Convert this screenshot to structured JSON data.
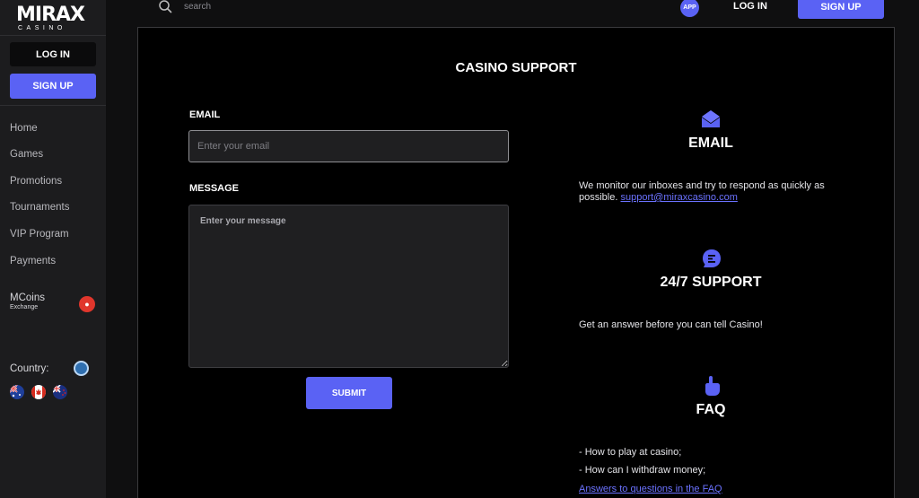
{
  "logo": {
    "main": "MIRAX",
    "sub": "CASINO"
  },
  "sidebar": {
    "login_label": "LOG IN",
    "signup_label": "SIGN UP",
    "nav": [
      "Home",
      "Games",
      "Promotions",
      "Tournaments",
      "VIP Program",
      "Payments"
    ],
    "mcoins": {
      "title": "MCoins",
      "subtitle": "Exchange"
    },
    "country_label": "Country:"
  },
  "topbar": {
    "search_placeholder": "search",
    "app_label": "APP",
    "login_label": "LOG IN",
    "signup_label": "SIGN UP"
  },
  "page": {
    "title": "CASINO SUPPORT",
    "form": {
      "email_label": "EMAIL",
      "email_placeholder": "Enter your email",
      "message_label": "MESSAGE",
      "message_placeholder": "Enter your message",
      "submit_label": "SUBMIT"
    },
    "email_info": {
      "heading": "EMAIL",
      "text": "We monitor our inboxes and try to respond as quickly as possible.",
      "link": "support@miraxcasino.com"
    },
    "support_info": {
      "heading": "24/7 SUPPORT",
      "text": "Get an answer before you can tell Casino!"
    },
    "faq_info": {
      "heading": "FAQ",
      "items": [
        "- How to play at casino;",
        "- How can I withdraw money;"
      ],
      "link": "Answers to questions in the FAQ"
    }
  },
  "colors": {
    "accent": "#5a62f4",
    "link": "#6b72ff",
    "sidebar_bg": "#1c1c1e"
  }
}
